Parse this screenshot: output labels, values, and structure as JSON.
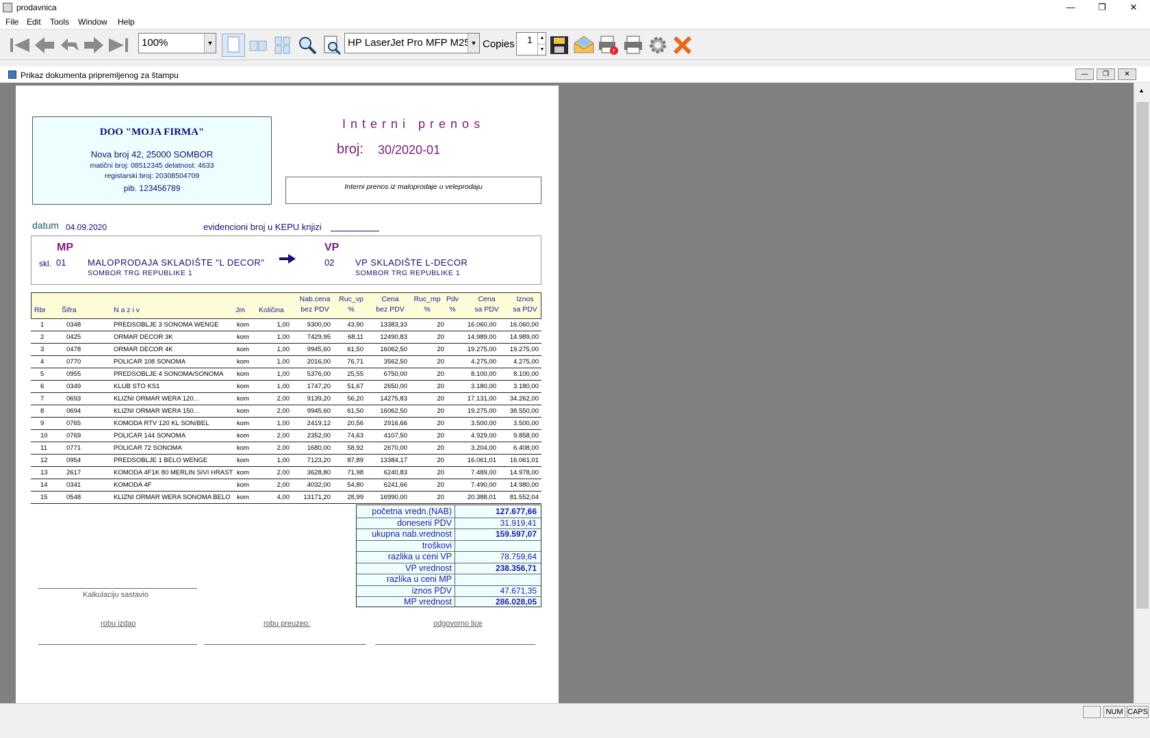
{
  "window": {
    "title": "prodavnica"
  },
  "menu": [
    "File",
    "Edit",
    "Tools",
    "Window",
    "Help"
  ],
  "toolbar": {
    "zoom": "100%",
    "printer": "HP LaserJet Pro MFP M25-",
    "copies_label": "Copies",
    "copies": "1"
  },
  "child_window": {
    "title": "Prikaz dokumenta pripremljenog za štampu"
  },
  "status": {
    "num": "NUM",
    "caps": "CAPS"
  },
  "doc": {
    "firm": {
      "name": "DOO  \"MOJA FIRMA\"",
      "address": "Nova broj 42, 25000 SOMBOR",
      "ids": "matični broj: 08512345  delatnost: 4633",
      "reg": "registarski broj: 20308504709",
      "pib": "pib. 123456789"
    },
    "title": "Interni prenos",
    "number_label": "broj:",
    "number": "30/2020-01",
    "description": "Interni prenos iz maloprodaje u veleprodaju",
    "date_label": "datum",
    "date": "04.09.2020",
    "kepu": "evidencioni broj u KEPU knjizi",
    "from": {
      "type": "MP",
      "skl_label": "skl.",
      "code": "01",
      "name": "MALOPRODAJA SKLADIŠTE \"L DECOR\"",
      "address": "SOMBOR TRG REPUBLIKE 1"
    },
    "to": {
      "type": "VP",
      "code": "02",
      "name": "VP SKLADIŠTE L-DECOR",
      "address": "SOMBOR TRG REPUBLIKE 1"
    },
    "headers": {
      "rbr": "Rbr",
      "sifra": "Šifra",
      "naziv": "N a z i v",
      "jm": "Jm",
      "kolicina": "Količina",
      "nab1": "Nab.cena",
      "nab2": "bez PDV",
      "rvp1": "Ruc_vp",
      "rvp2": "%",
      "cena1": "Cena",
      "cena2": "bez PDV",
      "rmp1": "Ruc_mp",
      "rmp2": "%",
      "pdv1": "Pdv",
      "pdv2": "%",
      "csa1": "Cena",
      "csa2": "sa PDV",
      "iz1": "Iznos",
      "iz2": "sa PDV"
    },
    "rows": [
      [
        "1",
        "0348",
        "PREDSOBLJE 3 SONOMA WENGE",
        "kom",
        "1,00",
        "9300,00",
        "43,90",
        "13383,33",
        "20",
        "16.060,00",
        "16.060,00"
      ],
      [
        "2",
        "0425",
        "ORMAR DECOR 3K",
        "kom",
        "1,00",
        "7429,95",
        "68,11",
        "12490,83",
        "20",
        "14.989,00",
        "14.989,00"
      ],
      [
        "3",
        "0478",
        "ORMAR DECOR 4K",
        "kom",
        "1,00",
        "9945,60",
        "61,50",
        "16062,50",
        "20",
        "19.275,00",
        "19.275,00"
      ],
      [
        "4",
        "0770",
        "POLICAR 108 SONOMA",
        "kom",
        "1,00",
        "2016,00",
        "76,71",
        "3562,50",
        "20",
        "4.275,00",
        "4.275,00"
      ],
      [
        "5",
        "0955",
        "PREDSOBLJE 4 SONOMA/SONOMA",
        "kom",
        "1,00",
        "5376,00",
        "25,55",
        "6750,00",
        "20",
        "8.100,00",
        "8.100,00"
      ],
      [
        "6",
        "0349",
        "KLUB STO KS1",
        "kom",
        "1,00",
        "1747,20",
        "51,67",
        "2650,00",
        "20",
        "3.180,00",
        "3.180,00"
      ],
      [
        "7",
        "0693",
        "KLIZNI ORMAR WERA 120...",
        "kom",
        "2,00",
        "9139,20",
        "56,20",
        "14275,83",
        "20",
        "17.131,00",
        "34.262,00"
      ],
      [
        "8",
        "0694",
        "KLIZNI ORMAR WERA 150...",
        "kom",
        "2,00",
        "9945,60",
        "61,50",
        "16062,50",
        "20",
        "19.275,00",
        "38.550,00"
      ],
      [
        "9",
        "0765",
        "KOMODA RTV 120 KL SON/BEL",
        "kom",
        "1,00",
        "2419,12",
        "20,56",
        "2916,66",
        "20",
        "3.500,00",
        "3.500,00"
      ],
      [
        "10",
        "0769",
        "POLICAR 144 SONOMA",
        "kom",
        "2,00",
        "2352,00",
        "74,63",
        "4107,50",
        "20",
        "4.929,00",
        "9.858,00"
      ],
      [
        "11",
        "0771",
        "POLICAR 72 SONOMA",
        "kom",
        "2,00",
        "1680,00",
        "58,92",
        "2670,00",
        "20",
        "3.204,00",
        "6.408,00"
      ],
      [
        "12",
        "0954",
        "PREDSOBLJE 1 BELO WENGE",
        "kom",
        "1,00",
        "7123,20",
        "87,89",
        "13384,17",
        "20",
        "16.061,01",
        "16.061,01"
      ],
      [
        "13",
        "2617",
        "KOMODA 4F1K 80 MERLIN SIVI HRAST",
        "kom",
        "2,00",
        "3628,80",
        "71,98",
        "6240,83",
        "20",
        "7.489,00",
        "14.978,00"
      ],
      [
        "14",
        "0341",
        "KOMODA 4F",
        "kom",
        "2,00",
        "4032,00",
        "54,80",
        "6241,66",
        "20",
        "7.490,00",
        "14.980,00"
      ],
      [
        "15",
        "0548",
        "KLIZNI ORMAR WERA SONOMA BELO",
        "kom",
        "4,00",
        "13171,20",
        "28,99",
        "16990,00",
        "20",
        "20.388,01",
        "81.552,04"
      ]
    ],
    "summary": [
      [
        "početna vredn.(NAB)",
        "127.677,66",
        true
      ],
      [
        "doneseni PDV",
        "31.919,41",
        false
      ],
      [
        "ukupna nab.vrednost",
        "159.597,07",
        true
      ],
      [
        "troškovi",
        "",
        false
      ],
      [
        "razlika u ceni VP",
        "78.759,64",
        false
      ],
      [
        "VP vrednost",
        "238.356,71",
        true
      ],
      [
        "razlika u ceni MP",
        "",
        false
      ],
      [
        "iznos PDV",
        "47.671,35",
        false
      ],
      [
        "MP vrednost",
        "286.028,05",
        true
      ]
    ],
    "signatures": {
      "kalk": "Kalkulaciju sastavio",
      "izdao": "robu izdao",
      "preuzeo": "robu preuzeo:",
      "odg": " odgovorno lice"
    }
  }
}
